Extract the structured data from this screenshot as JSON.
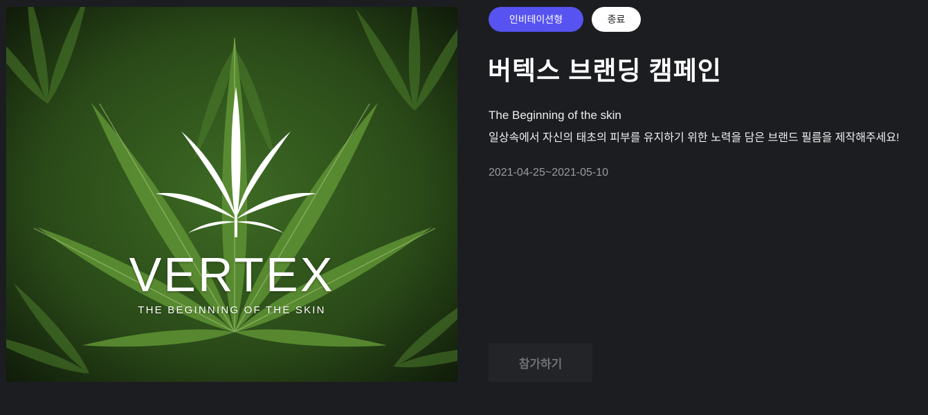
{
  "campaign": {
    "image": {
      "brand_word": "VERTEX",
      "brand_tagline": "THE BEGINNING OF THE SKIN",
      "icon": "cannabis-leaf-icon"
    },
    "badges": {
      "type": "인비테이션형",
      "status": "종료"
    },
    "title": "버텍스 브랜딩 캠페인",
    "subtitle": "The Beginning of the skin",
    "description": "일상속에서 자신의 태초의 피부를 유지하기 위한 노력을 담은 브랜드 필름을 제작해주세요!",
    "period": "2021-04-25~2021-05-10",
    "join_label": "참가하기"
  },
  "colors": {
    "background": "#1c1d21",
    "type_badge": "#5653f0",
    "status_badge": "#ffffff",
    "button_disabled": "#232428"
  }
}
